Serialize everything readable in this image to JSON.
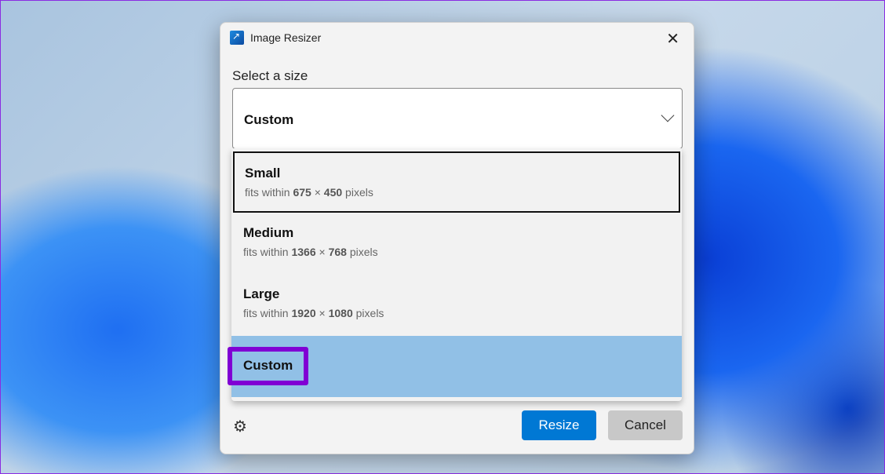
{
  "window": {
    "title": "Image Resizer",
    "close": "✕"
  },
  "label": "Select a size",
  "combo": {
    "value": "Custom"
  },
  "options": [
    {
      "name": "Small",
      "prefix": "fits within",
      "w": "675",
      "x": "×",
      "h": "450",
      "unit": "pixels"
    },
    {
      "name": "Medium",
      "prefix": "fits within",
      "w": "1366",
      "x": "×",
      "h": "768",
      "unit": "pixels"
    },
    {
      "name": "Large",
      "prefix": "fits within",
      "w": "1920",
      "x": "×",
      "h": "1080",
      "unit": "pixels"
    },
    {
      "name": "Custom"
    }
  ],
  "footer": {
    "settings": "⚙",
    "resize": "Resize",
    "cancel": "Cancel"
  }
}
